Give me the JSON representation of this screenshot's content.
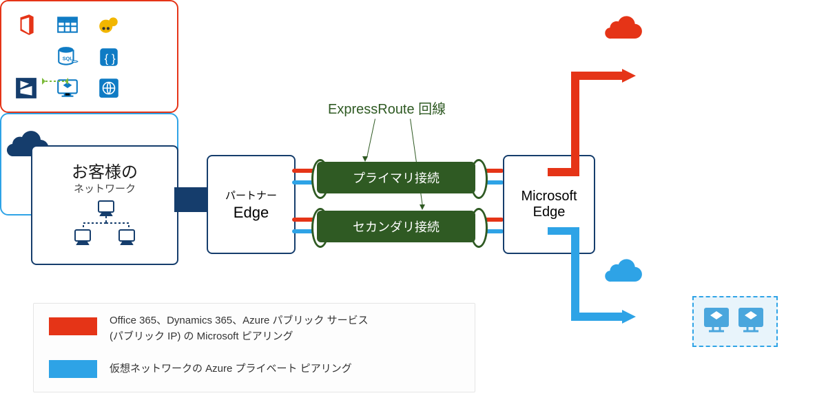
{
  "colors": {
    "navy": "#153d6c",
    "red": "#e53417",
    "blue": "#2ea3e6",
    "green": "#2f5a23"
  },
  "customer": {
    "title": "お客様の",
    "subtitle": "ネットワーク"
  },
  "partnerEdge": {
    "line1": "パートナー",
    "line2": "Edge"
  },
  "msEdge": {
    "line1": "Microsoft",
    "line2": "Edge"
  },
  "circuit": {
    "label": "ExpressRoute 回線",
    "primary": "プライマリ接続",
    "secondary": "セカンダリ接続"
  },
  "legend": {
    "item1": "Office 365、Dynamics 365、Azure パブリック サービス\n(パブリック IP) の Microsoft ピアリング",
    "item2": "仮想ネットワークの Azure プライベート ピアリング"
  },
  "topServices": {
    "icons": [
      "office-365",
      "storage-table",
      "hdinsight",
      "sql-database",
      "logic-apps",
      "dynamics-365",
      "virtual-machine",
      "web-app"
    ]
  },
  "bottomServices": {
    "label": "virtual-network-subnet"
  }
}
